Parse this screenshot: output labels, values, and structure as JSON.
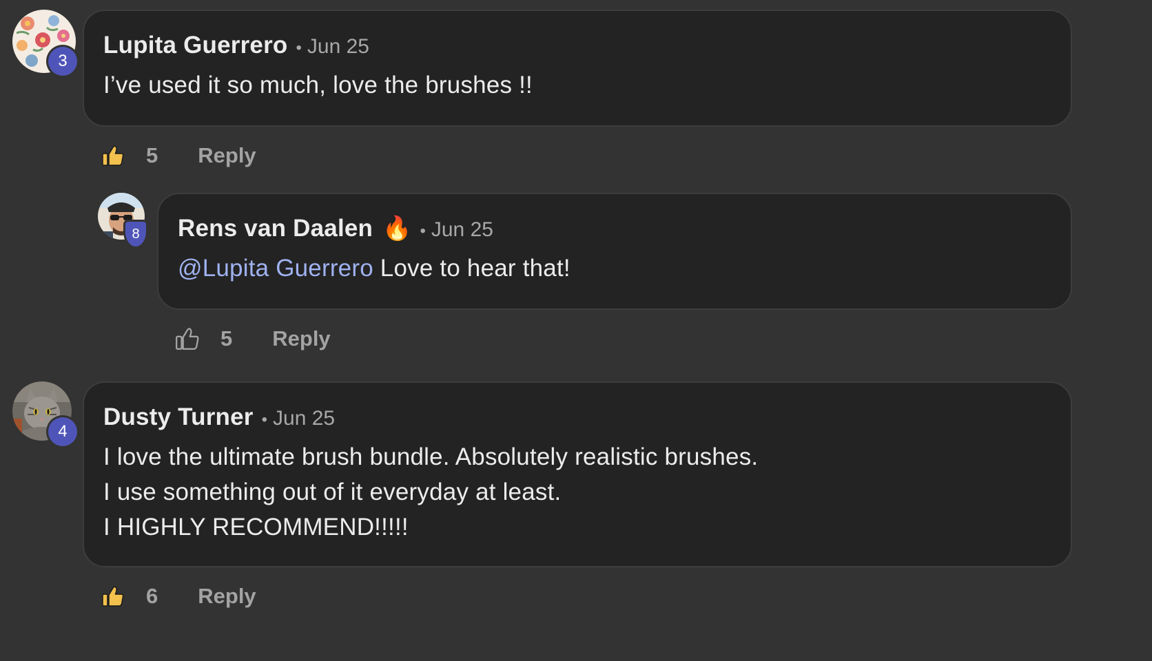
{
  "colors": {
    "background": "#333333",
    "bubble": "#232323",
    "badge": "#4f55b8",
    "mention": "#9fb2f0",
    "muted": "#a8a8a8",
    "like_filled": "#f2c14e"
  },
  "comments": [
    {
      "author": "Lupita Guerrero",
      "separator": "•",
      "date": "Jun 25",
      "level": "3",
      "body_lines": [
        "I’ve used it so much, love the brushes !!"
      ],
      "likes": "5",
      "liked": true,
      "reply_label": "Reply",
      "avatar_icon": "floral-avatar-icon"
    },
    {
      "author": "Rens van Daalen",
      "author_emoji": "🔥",
      "separator": "•",
      "date": "Jun 25",
      "level": "8",
      "mention": "@Lupita Guerrero",
      "body_rest": " Love to hear that!",
      "likes": "5",
      "liked": false,
      "reply_label": "Reply",
      "avatar_icon": "man-with-sunglasses-avatar-icon"
    },
    {
      "author": "Dusty Turner",
      "separator": "•",
      "date": "Jun 25",
      "level": "4",
      "body_lines": [
        "I love the ultimate brush bundle. Absolutely realistic brushes.",
        "I use something out of it everyday at least.",
        "I HIGHLY RECOMMEND!!!!!"
      ],
      "likes": "6",
      "liked": true,
      "reply_label": "Reply",
      "avatar_icon": "cat-avatar-icon"
    }
  ]
}
